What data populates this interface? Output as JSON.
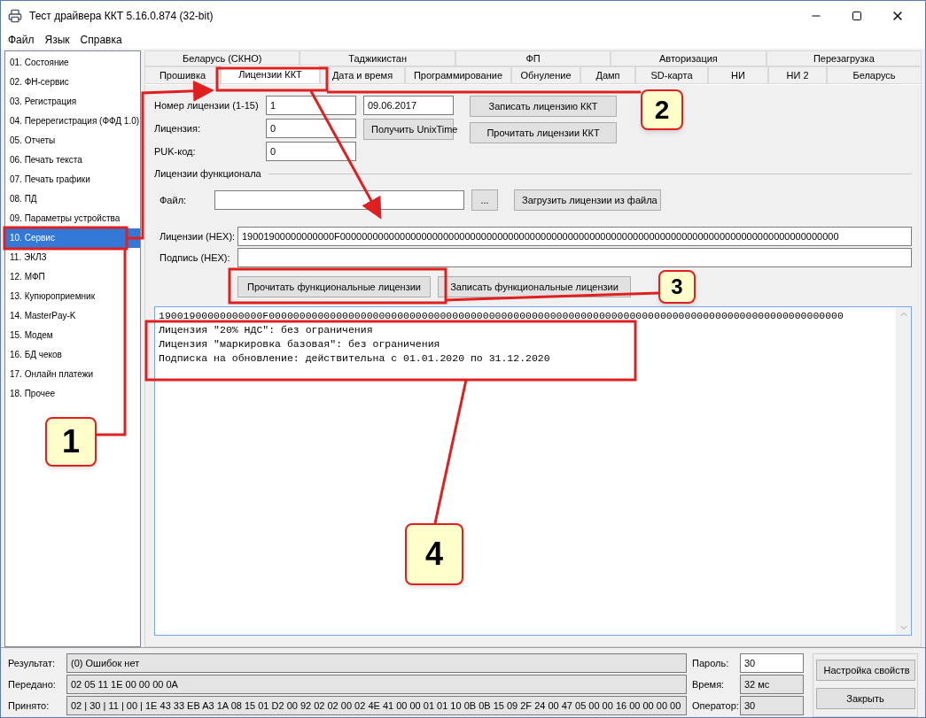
{
  "window": {
    "title": "Тест драйвера ККТ 5.16.0.874 (32-bit)"
  },
  "menu": [
    "Файл",
    "Язык",
    "Справка"
  ],
  "sidebar": {
    "items": [
      {
        "label": "01. Состояние",
        "selected": false
      },
      {
        "label": "02. ФН-сервис",
        "selected": false
      },
      {
        "label": "03. Регистрация",
        "selected": false
      },
      {
        "label": "04. Перерегистрация (ФФД 1.0)",
        "selected": false
      },
      {
        "label": "05. Отчеты",
        "selected": false
      },
      {
        "label": "06. Печать текста",
        "selected": false
      },
      {
        "label": "07. Печать графики",
        "selected": false
      },
      {
        "label": "08. ПД",
        "selected": false
      },
      {
        "label": "09. Параметры устройства",
        "selected": false
      },
      {
        "label": "10. Сервис",
        "selected": true
      },
      {
        "label": "11. ЭКЛЗ",
        "selected": false
      },
      {
        "label": "12. МФП",
        "selected": false
      },
      {
        "label": "13. Купюроприемник",
        "selected": false
      },
      {
        "label": "14. MasterPay-K",
        "selected": false
      },
      {
        "label": "15. Модем",
        "selected": false
      },
      {
        "label": "16. БД чеков",
        "selected": false
      },
      {
        "label": "17. Онлайн платежи",
        "selected": false
      },
      {
        "label": "18. Прочее",
        "selected": false
      }
    ]
  },
  "tabs": {
    "top_row": [
      {
        "label": "Беларусь (СКНО)",
        "selected": false
      },
      {
        "label": "Таджикистан",
        "selected": false
      },
      {
        "label": "ФП",
        "selected": false
      },
      {
        "label": "Авторизация",
        "selected": false
      },
      {
        "label": "Перезагрузка",
        "selected": false
      }
    ],
    "bottom_row": [
      {
        "label": "Прошивка",
        "selected": false
      },
      {
        "label": "Лицензии ККТ",
        "selected": true
      },
      {
        "label": "Дата и время",
        "selected": false
      },
      {
        "label": "Программирование",
        "selected": false
      },
      {
        "label": "Обнуление",
        "selected": false
      },
      {
        "label": "Дамп",
        "selected": false
      },
      {
        "label": "SD-карта",
        "selected": false
      },
      {
        "label": "НИ",
        "selected": false
      },
      {
        "label": "НИ 2",
        "selected": false
      },
      {
        "label": "Беларусь",
        "selected": false
      }
    ]
  },
  "license_form": {
    "fields": [
      {
        "label": "Номер лицензии (1-15)",
        "value": "1"
      },
      {
        "label": "Лицензия:",
        "value": "0"
      },
      {
        "label": "PUK-код:",
        "value": "0"
      }
    ],
    "date": "09.06.2017",
    "unixtime_button": "Получить UnixTime",
    "buttons": [
      "Записать лицензию ККТ",
      "Прочитать лицензии ККТ"
    ]
  },
  "functional_licenses": {
    "title": "Лицензии функционала",
    "file_label": "Файл:",
    "browse_button": "...",
    "load_button": "Загрузить лицензии из файла",
    "hex_label": "Лицензии (HEX):",
    "hex_value": "19001900000000000F00000000000000000000000000000000000000000000000000000000000000000000000000000000000000000000",
    "signature_label": "Подпись (HEX):",
    "buttons": [
      "Прочитать функциональные лицензии",
      "Записать функциональные лицензии"
    ]
  },
  "output_lines": [
    "19001900000000000F0000000000000000000000000000000000000000000000000000000000000000000000000000000000000000000000",
    "Лицензия \"20% НДС\": без ограничения",
    "Лицензия \"маркировка базовая\": без ограничения",
    "Подписка на обновление: действительна с 01.01.2020 по 31.12.2020"
  ],
  "status": {
    "rows": [
      {
        "label": "Результат:",
        "value": "(0) Ошибок нет"
      },
      {
        "label": "Передано:",
        "value": "02 05 11 1E 00 00 00 0A"
      },
      {
        "label": "Принято:",
        "value": "02 | 30 | 11 | 00 | 1E 43 33 EB A3 1A 08 15 01 D2 00 92 02 02 00 02 4E 41 00 00 01 01 10 0B 0B 15 09 2F 24 00 47 05 00 00 16 00 00 00 00"
      }
    ],
    "side": [
      {
        "label": "Пароль:",
        "value": "30",
        "editable": true
      },
      {
        "label": "Время:",
        "value": "32 мс",
        "editable": false
      },
      {
        "label": "Оператор:",
        "value": "30",
        "editable": false
      }
    ],
    "buttons": [
      "Настройка свойств",
      "Закрыть"
    ]
  },
  "callouts": [
    "1",
    "2",
    "3",
    "4"
  ]
}
